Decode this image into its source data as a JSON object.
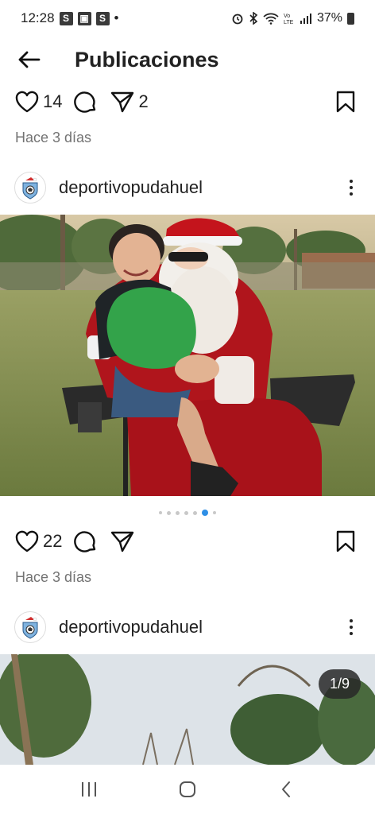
{
  "status_bar": {
    "time": "12:28",
    "badges": [
      "S",
      "▣",
      "S"
    ],
    "dot": "•",
    "icons": [
      "alarm-icon",
      "bluetooth-icon",
      "wifi-icon",
      "volte-icon",
      "signal-icon"
    ],
    "battery": "37%"
  },
  "header": {
    "back_icon": "arrow-left-icon",
    "title": "Publicaciones"
  },
  "posts": [
    {
      "likes": "14",
      "shares": "2",
      "time": "Hace 3 días"
    },
    {
      "username": "deportivopudahuel",
      "likes": "22",
      "time": "Hace 3 días",
      "carousel": {
        "total_dots": 7,
        "active_dot": 5
      }
    },
    {
      "username": "deportivopudahuel",
      "counter": "1/9"
    }
  ],
  "nav": {
    "recent_icon": "recent-apps-icon",
    "home_icon": "home-icon",
    "back_icon": "back-chevron-icon"
  },
  "colors": {
    "accent_dot": "#2f8fe6",
    "text_secondary": "#737373"
  }
}
